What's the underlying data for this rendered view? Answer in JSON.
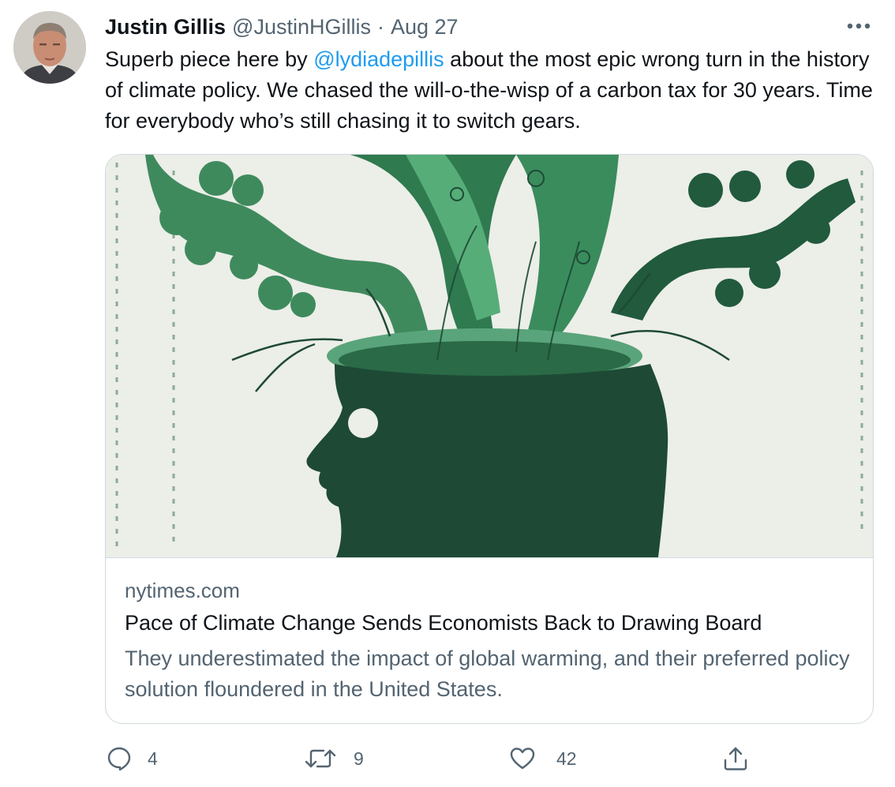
{
  "tweet": {
    "author": {
      "name": "Justin Gillis",
      "handle": "@JustinHGillis",
      "separator": "·",
      "date": "Aug 27"
    },
    "text": {
      "before_mention": "Superb piece here by ",
      "mention": "@lydiadepillis",
      "after_mention": " about the most epic wrong turn in the history of climate policy. We chased the will-o-the-wisp of a carbon tax for 30 years. Time for everybody who’s still chasing it to switch gears."
    },
    "card": {
      "domain": "nytimes.com",
      "title": "Pace of Climate Change Sends Economists Back to Drawing Board",
      "description": "They underestimated the impact of global warming, and their preferred policy solution floundered in the United States."
    },
    "actions": {
      "replies": "4",
      "retweets": "9",
      "likes": "42"
    }
  },
  "icons": {
    "more": "more-horizontal-icon",
    "reply": "reply-icon",
    "retweet": "retweet-icon",
    "like": "heart-icon",
    "share": "share-icon"
  },
  "colors": {
    "text_primary": "#0f1419",
    "text_secondary": "#536471",
    "link_blue": "#1d9bf0",
    "border": "#cfd9de",
    "illustration_dark_green": "#1e4a35",
    "illustration_mid_green": "#2f7a4f",
    "illustration_light_green": "#5bb37f",
    "illustration_background": "#eef0ea"
  }
}
